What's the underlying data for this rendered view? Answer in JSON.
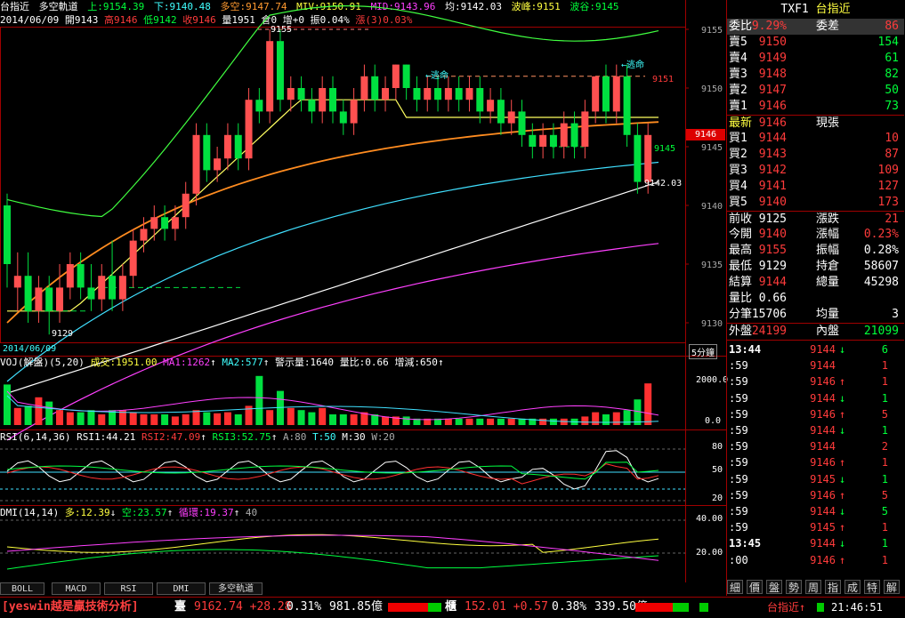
{
  "top_info": {
    "symbol": "台指近",
    "indicator": "多空軌道",
    "up": "上:9154.39",
    "down": "下:9140.48",
    "mid_line": "多空:9147.74",
    "mtv": "MIV:9150.91",
    "mid": "MID:9143.96",
    "avg": "均:9142.03",
    "wave_peak": "波峰:9151",
    "wave_trough": "波谷:9145",
    "line2_date": "2014/06/09",
    "line2_open": "開9143",
    "line2_high": "高9146",
    "line2_low": "低9142",
    "line2_close": "收9146",
    "line2_vol": "量1951",
    "line2_oi": "倉0",
    "line2_inc": "增+0",
    "line2_amp": "振0.04%",
    "line2_chg": "漲(3)0.03%"
  },
  "price_axis": [
    "9155",
    "9150",
    "9145",
    "9140",
    "9135",
    "9130"
  ],
  "price_tag": "9146",
  "annotations": {
    "high_label": "9155",
    "low_label": "9129",
    "peak_label": "9151",
    "trough_label": "9145",
    "avg_label": "9142.03",
    "escape1": "逃命",
    "escape2": "逃命"
  },
  "date_label": "2014/06/09",
  "period_label": "5分鐘",
  "vol_title": {
    "name": "VOJ(解盤)(5,20)",
    "vol": "成交:1951.00",
    "ma1": "MA1:1262",
    "ma2": "MA2:577",
    "warn": "警示量:1640",
    "ratio": "量比:0.66",
    "change": "增減:650"
  },
  "vol_axis": [
    "2000.0",
    "0.0"
  ],
  "rsi_title": {
    "name": "RSI(6,14,36)",
    "r1": "RSI1:44.21",
    "r2": "RSI2:47.09",
    "r3": "RSI3:52.75",
    "a": "A:80",
    "t": "T:50",
    "m": "M:30",
    "w": "W:20"
  },
  "rsi_axis": [
    "80",
    "50",
    "20"
  ],
  "dmi_title": {
    "name": "DMI(14,14)",
    "plus": "多:12.39",
    "minus": "空:23.57",
    "adx": "循環:19.37",
    "level": "40"
  },
  "dmi_axis": [
    "40.00",
    "20.00"
  ],
  "bottom_tabs": [
    "BOLL",
    "MACD",
    "RSI",
    "DMI",
    "多空軌道"
  ],
  "status_bar": {
    "brand": "[yeswin越是贏技術分析]",
    "tw_label": "臺",
    "tw_value": "9162.74 +28.28",
    "tw_pct": "0.31%",
    "tw_amount": "981.85億",
    "otc_label": "櫃",
    "otc_value": "152.01 +0.57",
    "otc_pct": "0.38%",
    "otc_amount": "339.50億",
    "symbol": "台指近",
    "time": "21:46:51"
  },
  "quote": {
    "code": "TXF1",
    "name": "台指近",
    "ratio_label": "委比",
    "ratio_value": "9.29%",
    "diff_label": "委差",
    "diff_value": "86",
    "asks": [
      {
        "label": "賣5",
        "price": "9150",
        "qty": "154"
      },
      {
        "label": "賣4",
        "price": "9149",
        "qty": "61"
      },
      {
        "label": "賣3",
        "price": "9148",
        "qty": "82"
      },
      {
        "label": "賣2",
        "price": "9147",
        "qty": "50"
      },
      {
        "label": "賣1",
        "price": "9146",
        "qty": "73"
      }
    ],
    "last_label": "最新",
    "last_value": "9146",
    "last_qty_label": "現張",
    "bids": [
      {
        "label": "買1",
        "price": "9144",
        "qty": "10"
      },
      {
        "label": "買2",
        "price": "9143",
        "qty": "87"
      },
      {
        "label": "買3",
        "price": "9142",
        "qty": "109"
      },
      {
        "label": "買4",
        "price": "9141",
        "qty": "127"
      },
      {
        "label": "買5",
        "price": "9140",
        "qty": "173"
      }
    ],
    "stats": [
      {
        "l1": "前收",
        "v1": "9125",
        "l2": "漲跌",
        "v2": "21"
      },
      {
        "l1": "今開",
        "v1": "9140",
        "l2": "漲幅",
        "v2": "0.23%"
      },
      {
        "l1": "最高",
        "v1": "9155",
        "l2": "振幅",
        "v2": "0.28%"
      },
      {
        "l1": "最低",
        "v1": "9129",
        "l2": "持倉",
        "v2": "58607"
      },
      {
        "l1": "結算",
        "v1": "9144",
        "l2": "總量",
        "v2": "45298"
      },
      {
        "l1": "量比",
        "v1": "0.66",
        "l2": "",
        "v2": ""
      },
      {
        "l1": "分筆",
        "v1": "15706",
        "l2": "均量",
        "v2": "3"
      }
    ],
    "outer_label": "外盤",
    "outer_value": "24199",
    "inner_label": "內盤",
    "inner_value": "21099"
  },
  "ticks": [
    {
      "time": "13:44",
      "price": "9144",
      "dir": "down",
      "vol": "6"
    },
    {
      "time": ":59",
      "price": "9144",
      "dir": "",
      "vol": "1"
    },
    {
      "time": ":59",
      "price": "9146",
      "dir": "up",
      "vol": "1"
    },
    {
      "time": ":59",
      "price": "9144",
      "dir": "down",
      "vol": "1"
    },
    {
      "time": ":59",
      "price": "9146",
      "dir": "up",
      "vol": "5"
    },
    {
      "time": ":59",
      "price": "9144",
      "dir": "down",
      "vol": "1"
    },
    {
      "time": ":59",
      "price": "9144",
      "dir": "",
      "vol": "2"
    },
    {
      "time": ":59",
      "price": "9146",
      "dir": "up",
      "vol": "1"
    },
    {
      "time": ":59",
      "price": "9145",
      "dir": "down",
      "vol": "1"
    },
    {
      "time": ":59",
      "price": "9146",
      "dir": "up",
      "vol": "5"
    },
    {
      "time": ":59",
      "price": "9144",
      "dir": "down",
      "vol": "5"
    },
    {
      "time": ":59",
      "price": "9145",
      "dir": "up",
      "vol": "1"
    },
    {
      "time": "13:45",
      "price": "9144",
      "dir": "down",
      "vol": "1"
    },
    {
      "time": ":00",
      "price": "9146",
      "dir": "up",
      "vol": "1"
    }
  ],
  "right_tabs": [
    "細",
    "價",
    "盤",
    "勢",
    "周",
    "指",
    "成",
    "特",
    "解"
  ],
  "colors": {
    "up": "#ff3b3b",
    "down": "#00ff3a",
    "border": "#a00000"
  }
}
